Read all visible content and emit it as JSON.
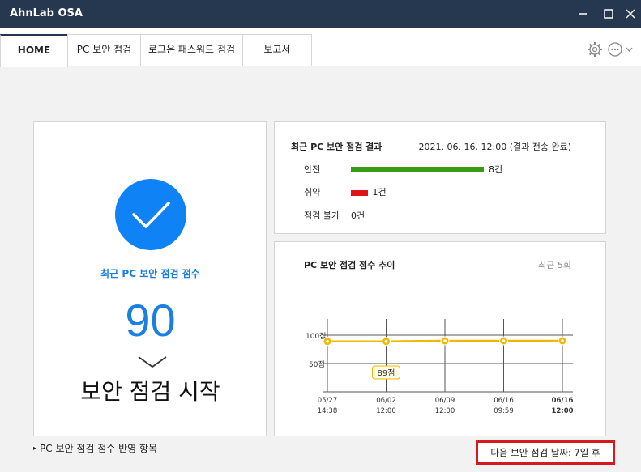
{
  "window": {
    "title": "AhnLab OSA",
    "minimize_icon": "minimize-icon",
    "maximize_icon": "maximize-icon",
    "close_icon": "close-icon"
  },
  "tabs": [
    {
      "label": "HOME",
      "active": true
    },
    {
      "label": "PC 보안 점검",
      "active": false
    },
    {
      "label": "로그온 패스워드 점검",
      "active": false
    },
    {
      "label": "보고서",
      "active": false
    }
  ],
  "toolbar_icons": [
    "gear-icon",
    "more-icon"
  ],
  "score_panel": {
    "label": "최근 PC 보안 점검 점수",
    "score": "90",
    "score_color": "#1a7fe0",
    "check_color": "#0f82f5",
    "start_button": "보안 점검 시작"
  },
  "result_panel": {
    "title": "최근 PC 보안 점검 결과",
    "date": "2021. 06. 16. 12:00 (결과 전송 완료)",
    "rows": [
      {
        "label": "안전",
        "count": "8건",
        "value": 8,
        "color": "#3a9a11"
      },
      {
        "label": "취약",
        "count": "1건",
        "value": 1,
        "color": "#e0121a"
      },
      {
        "label": "점검 불가",
        "count": "0건",
        "value": 0,
        "color": "#cccccc"
      }
    ]
  },
  "trend_panel": {
    "title": "PC 보안 점검 점수 추이",
    "recent_label": "최근 5회"
  },
  "chart_data": {
    "type": "line",
    "title": "PC 보안 점검 점수 추이",
    "x": [
      "05/27 14:38",
      "06/02 12:00",
      "06/09 12:00",
      "06/16 09:59",
      "06/16 12:00"
    ],
    "x_date": [
      "05/27",
      "06/02",
      "06/09",
      "06/16",
      "06/16"
    ],
    "x_time": [
      "14:38",
      "12:00",
      "12:00",
      "09:59",
      "12:00"
    ],
    "series": [
      {
        "values": [
          89,
          89,
          90,
          90,
          90
        ],
        "color": "#f0b800"
      }
    ],
    "y_ticks": [
      "100점",
      "50점"
    ],
    "ylim": [
      0,
      100
    ],
    "annotation": "89점",
    "grid": true
  },
  "footer": {
    "link": "PC 보안 점검 점수 반영 항목",
    "next_check": "다음 보안 점검 날짜: 7일 후"
  }
}
